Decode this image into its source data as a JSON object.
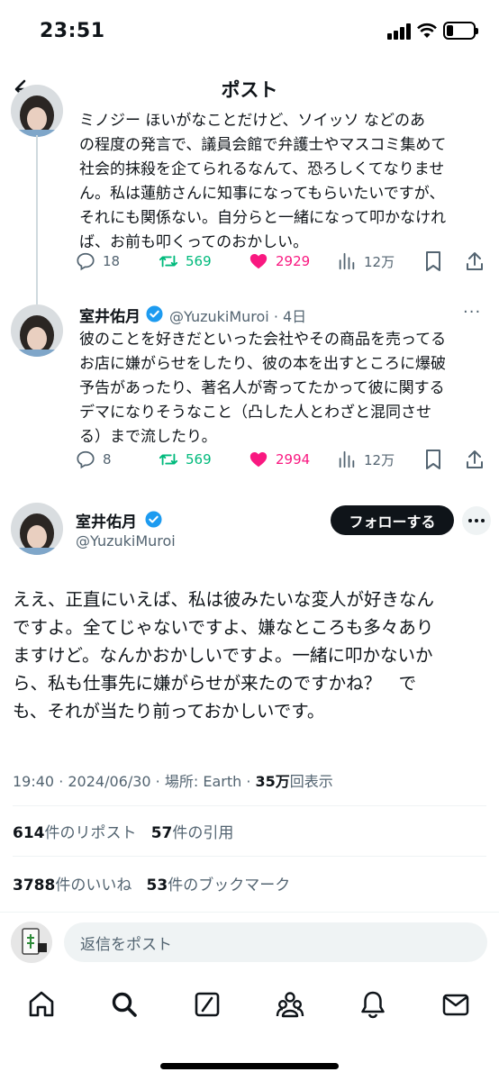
{
  "status": {
    "time": "23:51",
    "battery_level": 0.25
  },
  "header": {
    "title": "ポスト"
  },
  "post1": {
    "text": "ミノジー ほいがなことだけど、ソイッソ などのあ\nの程度の発言で、議員会館で弁護士やマスコミ集めて\n社会的抹殺を企てられるなんて、恐ろしくてなりませ\nん。私は蓮舫さんに知事になってもらいたいですが、\nそれにも関係ない。自分らと一緒になって叩かなけれ\nば、お前も叩くってのおかしい。",
    "replies": "18",
    "reposts": "569",
    "likes": "2929",
    "views": "12万"
  },
  "post2": {
    "name": "室井佑月",
    "handle": "@YuzukiMuroi",
    "time": "4日",
    "text": "彼のことを好きだといった会社やその商品を売ってる\nお店に嫌がらせをしたり、彼の本を出すところに爆破\n予告があったり、著名人が寄ってたかって彼に関する\nデマになりそうなこと（凸した人とわざと混同させ\nる）まで流したり。",
    "replies": "8",
    "reposts": "569",
    "likes": "2994",
    "views": "12万"
  },
  "main": {
    "name": "室井佑月",
    "handle": "@YuzukiMuroi",
    "follow_label": "フォローする",
    "text": "ええ、正直にいえば、私は彼みたいな変人が好きなん\nですよ。全てじゃないですよ、嫌なところも多々あり\nますけど。なんかおかしいですよ。一緒に叩かないか\nら、私も仕事先に嫌がらせが来たのですかね？　で\nも、それが当たり前っておかしいです。",
    "time": "19:40 · 2024/06/30",
    "location": "場所: Earth",
    "views_count": "35万",
    "views_label": "回表示",
    "reposts_count": "614",
    "reposts_label": "件のリポスト",
    "quotes_count": "57",
    "quotes_label": "件の引用",
    "likes_count": "3788",
    "likes_label": "件のいいね",
    "bookmarks_count": "53",
    "bookmarks_label": "件のブックマーク"
  },
  "reply": {
    "placeholder": "返信をポスト"
  },
  "colors": {
    "repost": "#00ba7c",
    "like": "#f91880",
    "muted": "#536471",
    "verified": "#1d9bf0"
  },
  "tabs": [
    "home-icon",
    "search-icon",
    "grok-icon",
    "communities-icon",
    "notifications-icon",
    "messages-icon"
  ]
}
